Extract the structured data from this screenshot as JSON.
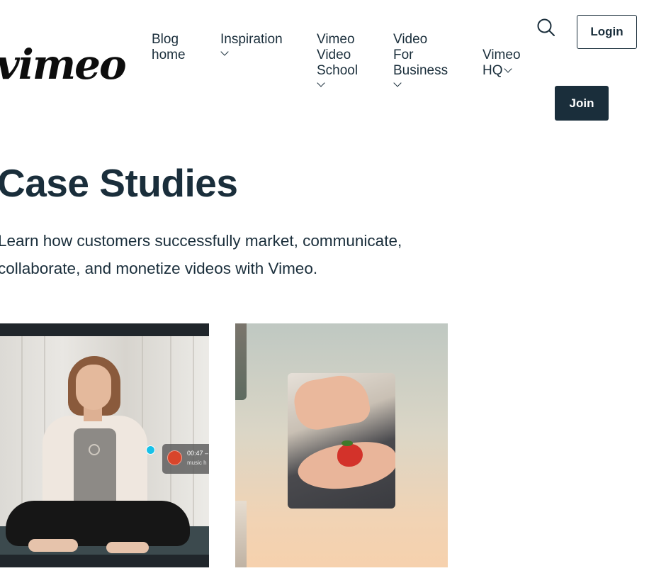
{
  "header": {
    "logo_text": "vimeo",
    "nav": [
      {
        "label": "Blog\nhome",
        "has_dropdown": false
      },
      {
        "label": "Inspiration",
        "has_dropdown": true
      },
      {
        "label": "Vimeo\nVideo\nSchool",
        "has_dropdown": true
      },
      {
        "label": "Video\nFor\nBusiness",
        "has_dropdown": true
      },
      {
        "label": "Vimeo\nHQ",
        "has_dropdown": true
      }
    ],
    "search_icon": "search-icon",
    "login_label": "Login",
    "join_label": "Join"
  },
  "hero": {
    "title": "Case Studies",
    "description": "Learn how customers successfully market, communicate, collaborate, and monetize videos with Vimeo."
  },
  "cards": [
    {
      "image": "woman-meditating-video-with-comment",
      "comment_time": "00:47 –",
      "comment_text": "music h"
    },
    {
      "image": "hands-holding-strawberry"
    }
  ],
  "colors": {
    "text": "#1a2e3b",
    "join_bg": "#1a2e3b",
    "accent_dot": "#17c1e8"
  }
}
